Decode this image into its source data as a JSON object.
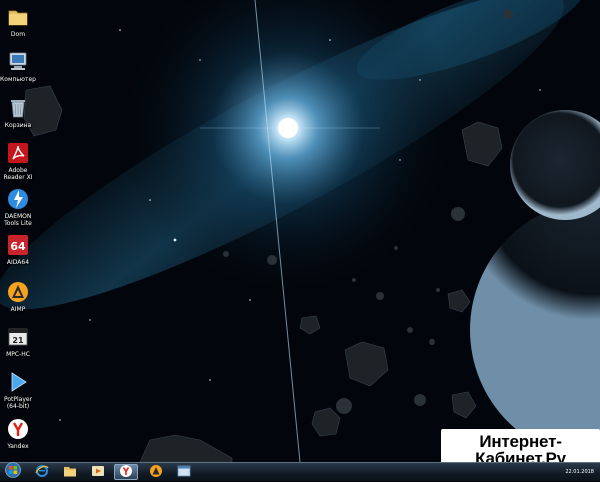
{
  "desktop_icons": [
    {
      "label": "Dom",
      "icon": "folder-icon"
    },
    {
      "label": "Компьютер",
      "icon": "computer-icon"
    },
    {
      "label": "Корзина",
      "icon": "recycle-bin-icon"
    },
    {
      "label": "Adobe Reader XI",
      "icon": "adobe-reader-icon"
    },
    {
      "label": "DAEMON Tools Lite",
      "icon": "daemon-tools-icon"
    },
    {
      "label": "AIDA64",
      "icon": "aida64-icon"
    },
    {
      "label": "AIMP",
      "icon": "aimp-icon"
    },
    {
      "label": "MPC-HC",
      "icon": "mpc-hc-icon"
    },
    {
      "label": "PotPlayer (64-bit)",
      "icon": "potplayer-icon"
    },
    {
      "label": "Yandex",
      "icon": "yandex-icon"
    }
  ],
  "watermark": {
    "line1": "Интернет-",
    "line2": "Кабинет.Ру"
  },
  "taskbar": {
    "buttons": [
      "start-orb-icon",
      "internet-explorer-icon",
      "explorer-folder-icon",
      "media-player-icon",
      "yandex-browser-icon",
      "aimp-taskbar-icon",
      "window-icon"
    ],
    "active": "yandex-browser-icon",
    "tray_time": "22.01.2018"
  },
  "colors": {
    "wallpaper_glow": "#bfe6ff",
    "nebula": "#1d5a7a",
    "taskbar": "#1a2634"
  }
}
